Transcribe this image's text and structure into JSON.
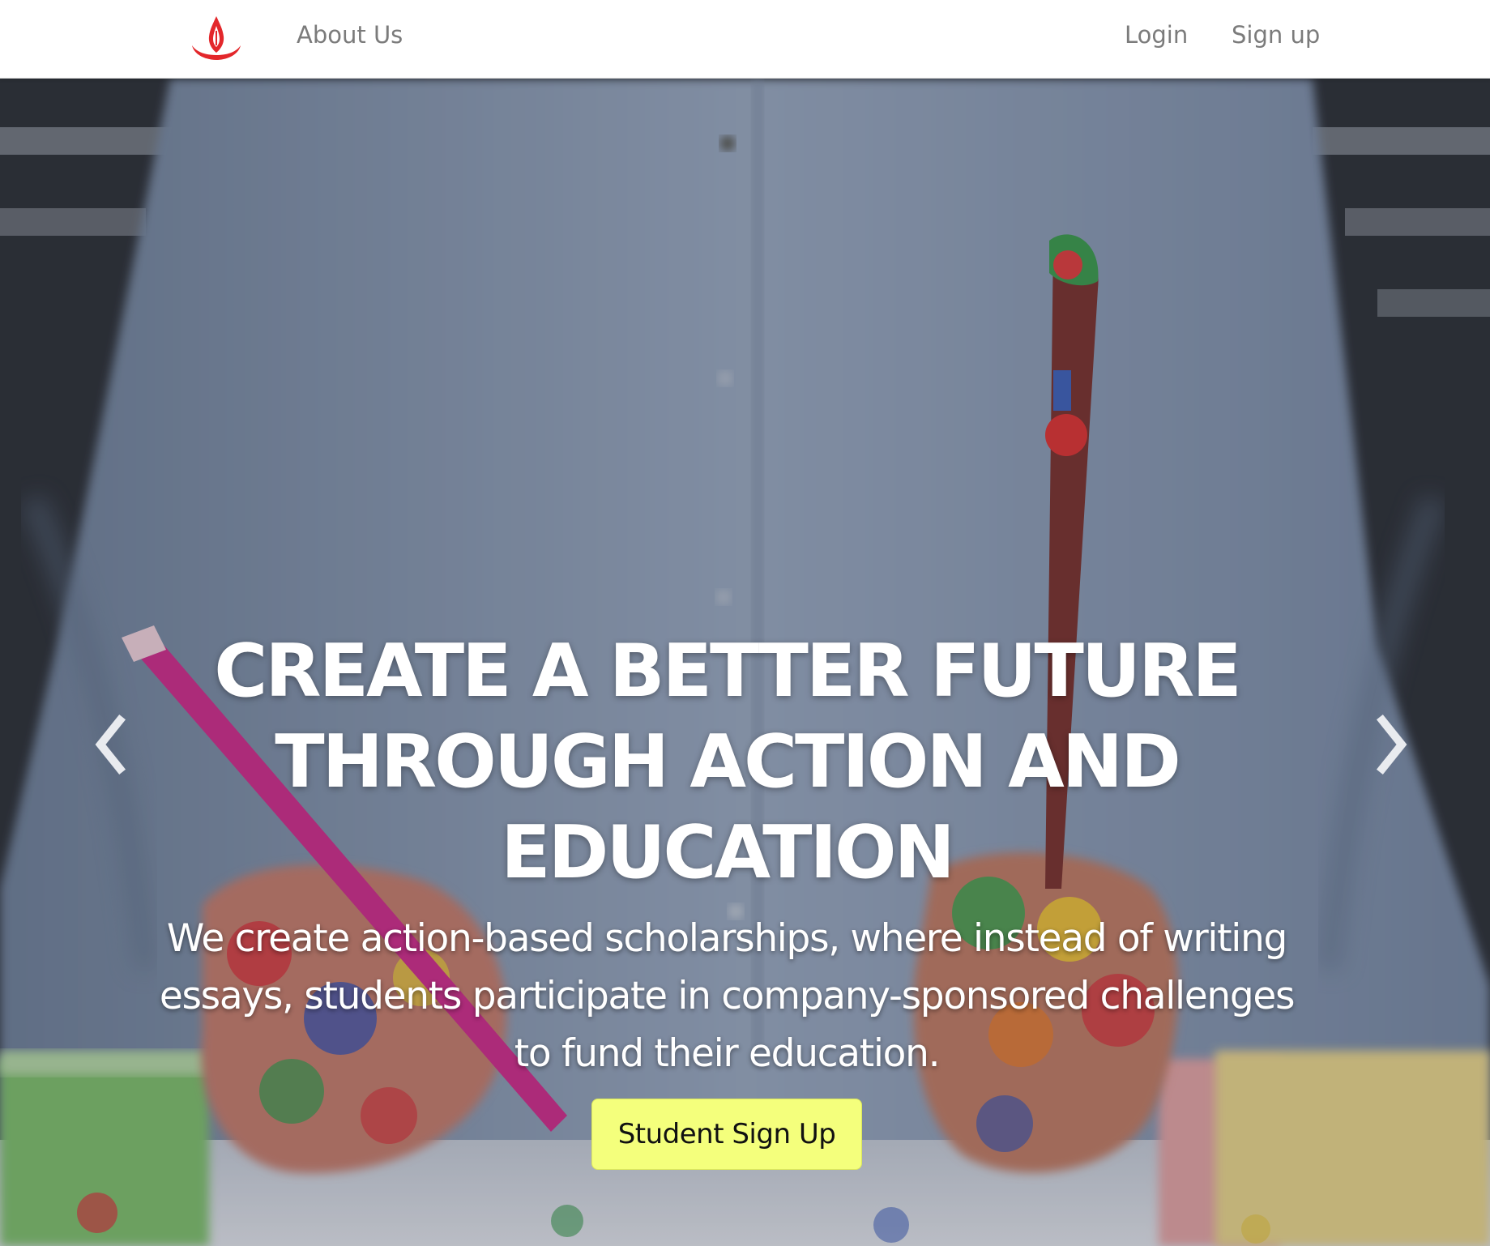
{
  "navbar": {
    "logo_icon": "flame-pen-logo-icon",
    "about_label": "About Us",
    "login_label": "Login",
    "signup_label": "Sign up"
  },
  "hero": {
    "background": "paint-covered-hands-holding-brushes-photo",
    "title": "CREATE A BETTER FUTURE THROUGH ACTION AND EDUCATION",
    "subtitle": "We create action-based scholarships, where instead of writing essays, students participate in company-sponsored challenges to fund their education.",
    "cta_label": "Student Sign Up",
    "prev_icon": "chevron-left-icon",
    "next_icon": "chevron-right-icon"
  },
  "colors": {
    "logo_red": "#e3272b",
    "nav_text": "#7b7b7b",
    "cta_background": "#f4ff7c",
    "hero_text": "#ffffff"
  }
}
